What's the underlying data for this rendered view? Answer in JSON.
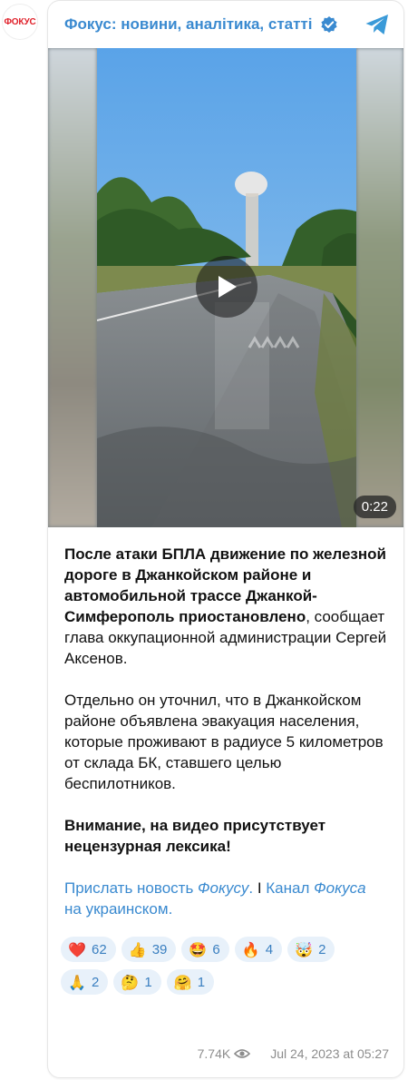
{
  "avatar": {
    "text": "ФОКУС"
  },
  "channel": {
    "title": "Фокус: новини, аналітика, статті"
  },
  "video": {
    "duration": "0:22"
  },
  "post": {
    "p1_bold": "После атаки БПЛА движение по железной дороге в Джанкойском районе и автомобильной трассе Джанкой-Симферополь приостановлено",
    "p1_rest": ", сообщает глава оккупационной администрации Сергей Аксенов.",
    "p2": "Отдельно он уточнил, что в Джанкойском районе объявлена эвакуация населения, которые проживают в радиусе 5 километров от склада БК, ставшего целью беспилотников.",
    "p3_bold": "Внимание, на видео присутствует нецензурная лексика!",
    "link1_text": "Прислать новость ",
    "link1_italic": "Фокусу",
    "link1_end": ".",
    "separator": " I ",
    "link2_text": "Канал ",
    "link2_italic": "Фокуса",
    "link2_end": " на украинском."
  },
  "reactions": [
    {
      "emoji": "❤️",
      "icon": "heart-icon",
      "count": "62"
    },
    {
      "emoji": "👍",
      "icon": "thumbs-up-icon",
      "count": "39"
    },
    {
      "emoji": "🤩",
      "icon": "star-struck-icon",
      "count": "6"
    },
    {
      "emoji": "🔥",
      "icon": "fire-icon",
      "count": "4"
    },
    {
      "emoji": "🤯",
      "icon": "exploding-head-icon",
      "count": "2"
    },
    {
      "emoji": "🙏",
      "icon": "folded-hands-icon",
      "count": "2"
    },
    {
      "emoji": "🤔",
      "icon": "thinking-face-icon",
      "count": "1"
    },
    {
      "emoji": "🤗",
      "icon": "hugging-face-icon",
      "count": "1"
    }
  ],
  "footer": {
    "views": "7.74K",
    "date": "Jul 24, 2023 at 05:27"
  },
  "colors": {
    "accent": "#3a8ad0",
    "reaction_bg": "#e8f1fa",
    "meta": "#8c8c8c",
    "brand_red": "#e0202a"
  }
}
